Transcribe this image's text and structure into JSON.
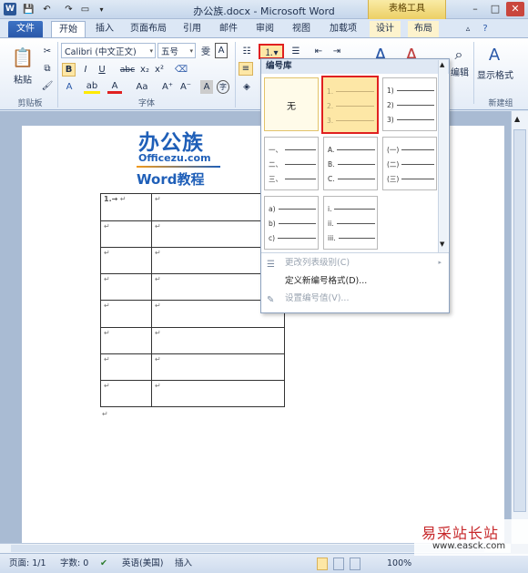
{
  "titlebar": {
    "title": "办公族.docx - Microsoft Word",
    "context_tab": "表格工具",
    "word_icon": "W",
    "min": "–",
    "max": "□",
    "close": "✕"
  },
  "tabs": [
    "文件",
    "开始",
    "插入",
    "页面布局",
    "引用",
    "邮件",
    "审阅",
    "视图",
    "加载项",
    "设计",
    "布局"
  ],
  "ribbon": {
    "paste_label": "粘贴",
    "font_name": "Calibri (中文正文)",
    "font_size": "五号",
    "groups": {
      "clipboard": "剪贴板",
      "font": "字体",
      "new_group": "新建组"
    },
    "edit_label": "编辑",
    "show_format_label": "显示格式",
    "bold": "B",
    "italic": "I",
    "underline": "U",
    "strike": "abc",
    "subscript": "x₂",
    "superscript": "x²",
    "grow": "A⁺",
    "shrink": "A⁻",
    "char_border": "A",
    "aa": "Aa",
    "wen": "雯",
    "font_color": "A",
    "highlight": "ab"
  },
  "dropdown": {
    "header": "编号库",
    "none_label": "无",
    "decimal": [
      "1.",
      "2.",
      "3."
    ],
    "paren": [
      "1)",
      "2)",
      "3)"
    ],
    "chinese_comma": [
      "一、",
      "二、",
      "三、"
    ],
    "upper_alpha": [
      "A.",
      "B.",
      "C."
    ],
    "chinese_paren": [
      "(一)",
      "(二)",
      "(三)"
    ],
    "lower_alpha": [
      "a)",
      "b)",
      "c)"
    ],
    "lower_roman": [
      "i.",
      "ii.",
      "iii."
    ],
    "menu": [
      {
        "label": "更改列表级别(C)",
        "disabled": true
      },
      {
        "label": "定义新编号格式(D)...",
        "disabled": false
      },
      {
        "label": "设置编号值(V)...",
        "disabled": true
      }
    ]
  },
  "document": {
    "logo_cn": "办公族",
    "logo_en": "Officezu.com",
    "logo_sub": "Word教程",
    "first_cell": "1.→",
    "para_mark": "↵"
  },
  "statusbar": {
    "page": "页面: 1/1",
    "words": "字数: 0",
    "language": "英语(美国)",
    "mode": "插入",
    "zoom": "100%"
  },
  "watermark": {
    "cn": "易采站长站",
    "url": "www.easck.com"
  }
}
